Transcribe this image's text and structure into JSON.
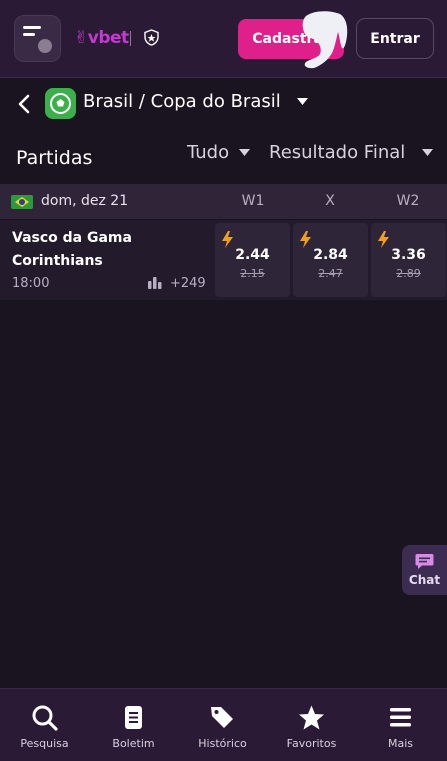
{
  "header": {
    "logo_text": "vbet",
    "register_label": "Cadastrar",
    "login_label": "Entrar"
  },
  "breadcrumb": {
    "title": "Brasil / Copa do Brasil"
  },
  "filters": {
    "section_title": "Partidas",
    "filter_all": "Tudo",
    "market": "Resultado Final"
  },
  "date_group": {
    "date": "dom, dez 21",
    "columns": [
      "W1",
      "X",
      "W2"
    ]
  },
  "match": {
    "team_home": "Vasco da Gama",
    "team_away": "Corinthians",
    "time": "18:00",
    "more_markets": "+249",
    "odds": [
      {
        "value": "2.44",
        "previous": "2.15"
      },
      {
        "value": "2.84",
        "previous": "2.47"
      },
      {
        "value": "3.36",
        "previous": "2.89"
      }
    ]
  },
  "chat": {
    "label": "Chat"
  },
  "bottom_nav": [
    {
      "label": "Pesquisa",
      "icon": "search-icon"
    },
    {
      "label": "Boletim",
      "icon": "betslip-icon"
    },
    {
      "label": "Histórico",
      "icon": "tags-icon"
    },
    {
      "label": "Favoritos",
      "icon": "star-icon"
    },
    {
      "label": "Mais",
      "icon": "menu-icon"
    }
  ],
  "colors": {
    "brand": "#c23ad0",
    "register": "#e0208a",
    "bolt": "#f0a020",
    "league_badge": "#3bb04a"
  }
}
